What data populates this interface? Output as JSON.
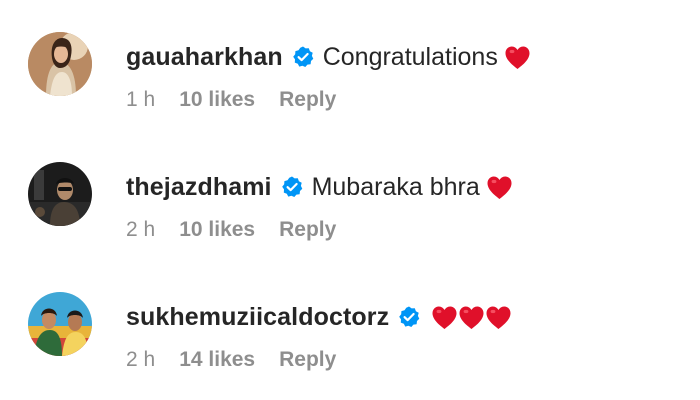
{
  "comments": [
    {
      "username": "gauaharkhan",
      "verified": true,
      "text": "Congratulations",
      "hearts": 1,
      "time": "1 h",
      "likes": "10 likes",
      "reply": "Reply"
    },
    {
      "username": "thejazdhami",
      "verified": true,
      "text": "Mubaraka bhra",
      "hearts": 1,
      "time": "2 h",
      "likes": "10 likes",
      "reply": "Reply"
    },
    {
      "username": "sukhemuziicaldoctorz",
      "verified": true,
      "text": "",
      "hearts": 3,
      "time": "2 h",
      "likes": "14 likes",
      "reply": "Reply"
    }
  ],
  "colors": {
    "text": "#262626",
    "meta": "#8e8e8e",
    "verified": "#0095f6",
    "heart": "#e0102a"
  }
}
